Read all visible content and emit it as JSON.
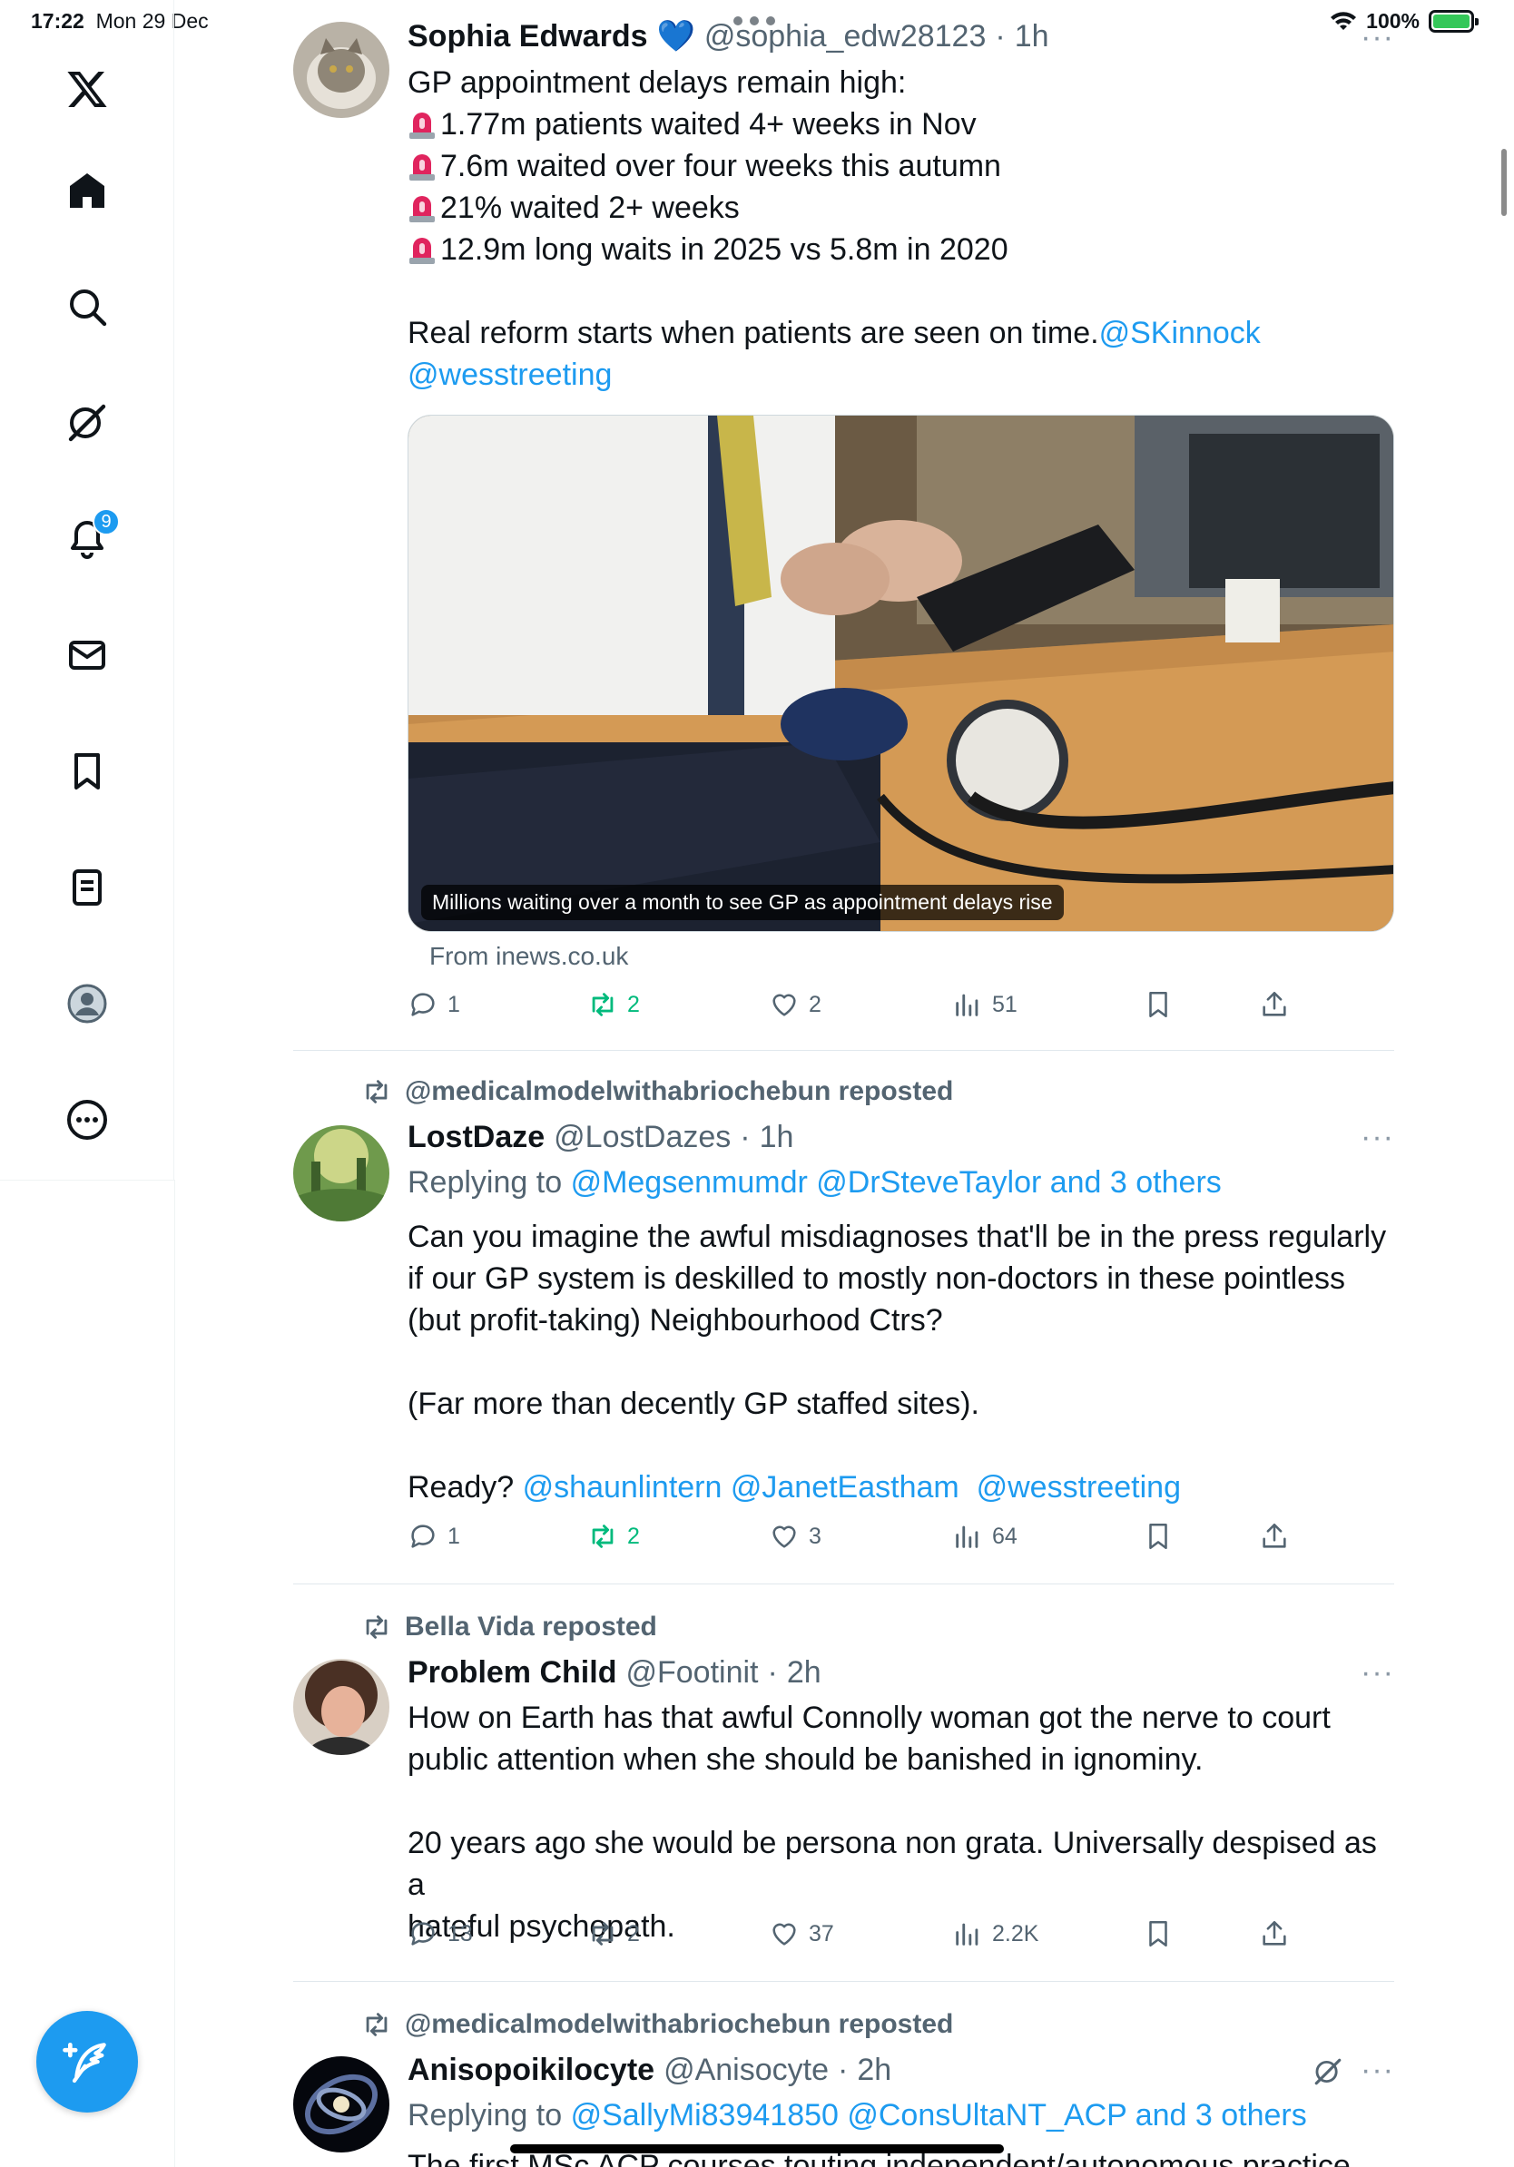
{
  "status_bar": {
    "time": "17:22",
    "date": "Mon 29 Dec",
    "battery": "100%"
  },
  "sidebar": {
    "items": [
      "logo",
      "home",
      "search",
      "grok",
      "notifications",
      "messages",
      "bookmarks",
      "lists",
      "profile",
      "more"
    ],
    "notification_count": "9"
  },
  "tweets": [
    {
      "name": "Sophia Edwards",
      "verified_emoji": "💙",
      "handle": "@sophia_edw28123",
      "time": "1h",
      "lines": [
        "GP appointment delays remain high:",
        "1.77m patients waited 4+ weeks in Nov",
        "7.6m waited over four weeks this autumn",
        "21% waited 2+ weeks",
        "12.9m long waits in 2025 vs 5.8m in 2020"
      ],
      "closing": "Real reform starts when patients are seen on time.",
      "mention1": "@SKinnock",
      "mention2": "@wesstreeting",
      "card_caption": "Millions waiting over a month to see GP as appointment delays rise",
      "card_source": "From inews.co.uk",
      "replies": "1",
      "reposts": "2",
      "likes": "2",
      "views": "51"
    },
    {
      "reposted_by": "@medicalmodelwithabriochebun reposted",
      "name": "LostDaze",
      "handle": "@LostDazes",
      "time": "1h",
      "replying_prefix": "Replying to",
      "replying_to": "@Megsenmumdr @DrSteveTaylor and 3 others",
      "p1_l1": "Can you imagine the awful misdiagnoses that'll be in the press regularly",
      "p1_l2": "if our GP system is deskilled to mostly non-doctors in these pointless",
      "p1_l3": "(but profit-taking) Neighbourhood Ctrs?",
      "p2": "(Far more than decently GP staffed sites).",
      "p3_prefix": "Ready?",
      "p3_mentions": "@shaunlintern @JanetEastham  @wesstreeting",
      "replies": "1",
      "reposts": "2",
      "likes": "3",
      "views": "64"
    },
    {
      "reposted_by": "Bella Vida reposted",
      "name": "Problem Child",
      "handle": "@Footinit",
      "time": "2h",
      "p1_l1": "How on Earth has that awful Connolly woman got the nerve to court",
      "p1_l2": "public attention when she should be banished in ignominy.",
      "p2_l1": "20 years ago she would be persona non grata. Universally despised as a",
      "p2_l2": "hateful psychopath.",
      "replies": "13",
      "reposts": "2",
      "likes": "37",
      "views": "2.2K"
    },
    {
      "reposted_by": "@medicalmodelwithabriochebun reposted",
      "name": "Anisopoikilocyte",
      "handle": "@Anisocyte",
      "time": "2h",
      "replying_prefix": "Replying to",
      "replying_to": "@SallyMi83941850 @ConsUltaNT_ACP and 3 others",
      "partial_text": "The first MSc ACP courses touting independent/autonomous practice"
    }
  ],
  "colors": {
    "accent": "#1d9bf0",
    "repost_green": "#00ba7c",
    "muted": "#536471"
  }
}
